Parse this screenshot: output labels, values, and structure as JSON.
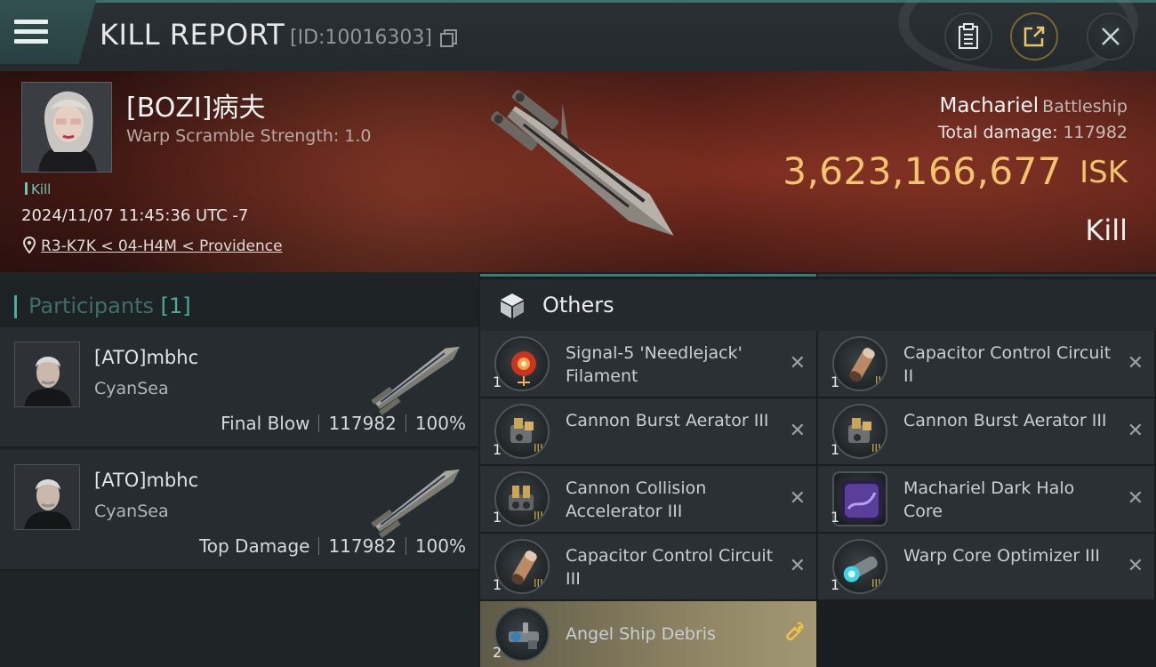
{
  "header": {
    "title": "KILL REPORT",
    "report_id": "[ID:10016303]"
  },
  "victim": {
    "name": "[BOZI]病夫",
    "warp_scramble": "Warp Scramble Strength: 1.0",
    "tag": "Kill",
    "timestamp": "2024/11/07 11:45:36 UTC -7",
    "location": "R3-K7K < 04-H4M < Providence"
  },
  "ship": {
    "name": "Machariel",
    "class": "Battleship",
    "damage_label": "Total damage:",
    "damage_value": "117982",
    "isk_value": "3,623,166,677",
    "isk_unit": "ISK",
    "result": "Kill"
  },
  "participants": {
    "label": "Participants",
    "count": "[1]",
    "list": [
      {
        "name": "[ATO]mbhc",
        "corp": "CyanSea",
        "role": "Final Blow",
        "damage": "117982",
        "percent": "100%"
      },
      {
        "name": "[ATO]mbhc",
        "corp": "CyanSea",
        "role": "Top Damage",
        "damage": "117982",
        "percent": "100%"
      }
    ]
  },
  "others": {
    "label": "Others",
    "items": [
      {
        "name": "Signal-5 'Needlejack' Filament",
        "qty": "1",
        "icon": "filament-icon"
      },
      {
        "name": "Capacitor Control Circuit II",
        "qty": "1",
        "icon": "capacitor-circuit-icon"
      },
      {
        "name": "Cannon Burst Aerator III",
        "qty": "1",
        "icon": "burst-aerator-icon"
      },
      {
        "name": "Cannon Burst Aerator III",
        "qty": "1",
        "icon": "burst-aerator-icon"
      },
      {
        "name": "Cannon Collision Accelerator III",
        "qty": "1",
        "icon": "collision-accelerator-icon"
      },
      {
        "name": "Machariel Dark Halo Core",
        "qty": "1",
        "icon": "halo-core-icon"
      },
      {
        "name": "Capacitor Control Circuit III",
        "qty": "1",
        "icon": "capacitor-circuit-icon"
      },
      {
        "name": "Warp Core Optimizer III",
        "qty": "1",
        "icon": "warp-optimizer-icon"
      },
      {
        "name": "Angel Ship Debris",
        "qty": "2",
        "icon": "ship-debris-icon"
      }
    ]
  },
  "colors": {
    "accent_teal": "#4fa9a0",
    "isk_gold": "#f2c46f",
    "highlight_gold": "#f0c04a"
  }
}
